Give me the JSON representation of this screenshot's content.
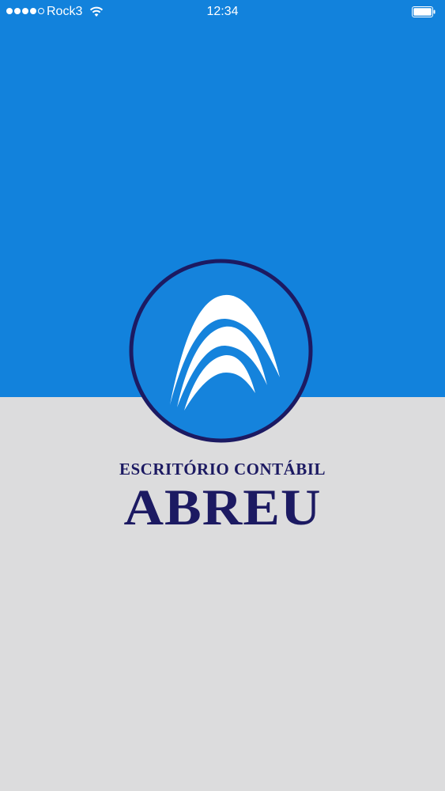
{
  "status_bar": {
    "carrier": "Rock3",
    "time": "12:34",
    "signal_bars_filled": 4,
    "signal_bars_total": 5,
    "icons": [
      "signal-dots-icon",
      "wifi-icon",
      "battery-icon"
    ]
  },
  "splash": {
    "logo_line": "ESCRITÓRIO CONTÁBIL",
    "logo_name": "ABREU",
    "logo_icon": "arches-logo-icon"
  },
  "colors": {
    "top_background": "#1282dc",
    "bottom_background": "#dcdcdd",
    "logo_navy": "#1c1a62",
    "logo_white": "#ffffff"
  }
}
